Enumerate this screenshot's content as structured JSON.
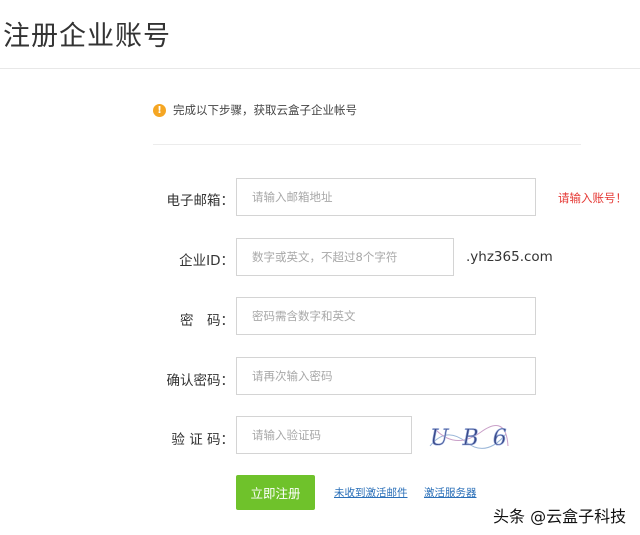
{
  "page": {
    "title": "注册企业账号"
  },
  "notice": {
    "text": "完成以下步骤，获取云盒子企业帐号",
    "icon": "warning-icon",
    "color": "#f5a623"
  },
  "form": {
    "email": {
      "label": "电子邮箱：",
      "placeholder": "请输入邮箱地址",
      "error": "请输入账号！"
    },
    "enterprise_id": {
      "label": "企业ID：",
      "placeholder": "数字或英文，不超过8个字符",
      "suffix": ".yhz365.com"
    },
    "password": {
      "label": "密　码：",
      "placeholder": "密码需含数字和英文"
    },
    "confirm_password": {
      "label": "确认密码：",
      "placeholder": "请再次输入密码"
    },
    "captcha": {
      "label": "验 证 码：",
      "placeholder": "请输入验证码",
      "image_text": "UB6"
    }
  },
  "actions": {
    "submit_label": "立即注册",
    "submit_color": "#6fc22b",
    "resend_link": "未收到激活邮件",
    "activate_server_link": "激活服务器"
  },
  "watermark": {
    "text": "头条 @云盒子科技"
  }
}
